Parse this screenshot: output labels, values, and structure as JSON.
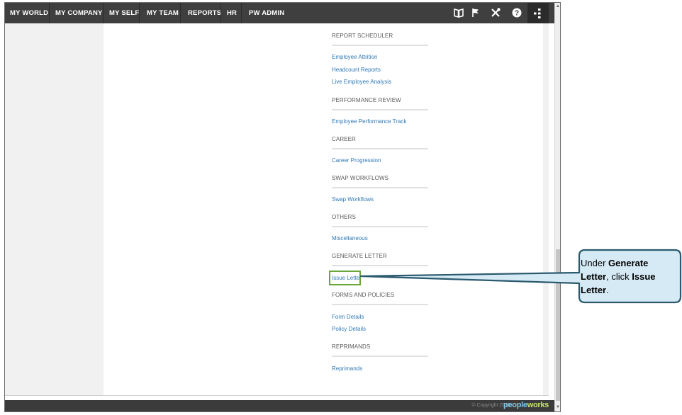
{
  "nav": {
    "items": [
      "MY WORLD",
      "MY COMPANY",
      "MY SELF",
      "MY TEAM",
      "REPORTS",
      "HR",
      "PW ADMIN"
    ],
    "icons": [
      "book-icon",
      "flag-icon",
      "tools-icon",
      "help-icon",
      "menu-icon"
    ]
  },
  "menu": {
    "sections": [
      {
        "header": "REPORT SCHEDULER",
        "links": [
          "Employee Attrition",
          "Headcount Reports",
          "Live Employee Analysis"
        ]
      },
      {
        "header": "PERFORMANCE REVIEW",
        "links": [
          "Employee Performance Track"
        ]
      },
      {
        "header": "CAREER",
        "links": [
          "Career Progression"
        ]
      },
      {
        "header": "SWAP WORKFLOWS",
        "links": [
          "Swap Workflows"
        ]
      },
      {
        "header": "OTHERS",
        "links": [
          "Miscellaneous"
        ]
      },
      {
        "header": "GENERATE LETTER",
        "links": [
          "Issue Letter"
        ]
      },
      {
        "header": "FORMS AND POLICIES",
        "links": [
          "Form Details",
          "Policy Details"
        ]
      },
      {
        "header": "REPRIMANDS",
        "links": [
          "Reprimands"
        ]
      }
    ]
  },
  "footer": {
    "copyright": "© Copyright 2015",
    "brand_part1": "people",
    "brand_part2": "works"
  },
  "callout": {
    "text_1": "Under ",
    "bold_1": "Generate Letter",
    "text_2": ", click ",
    "bold_2": "Issue Letter",
    "text_3": "."
  },
  "colors": {
    "nav_background": "#3f3f3f",
    "link": "#2f78b5",
    "highlight": "#69a73a",
    "callout_fill": "#d5eaf5",
    "callout_border": "#2b5a6e"
  }
}
